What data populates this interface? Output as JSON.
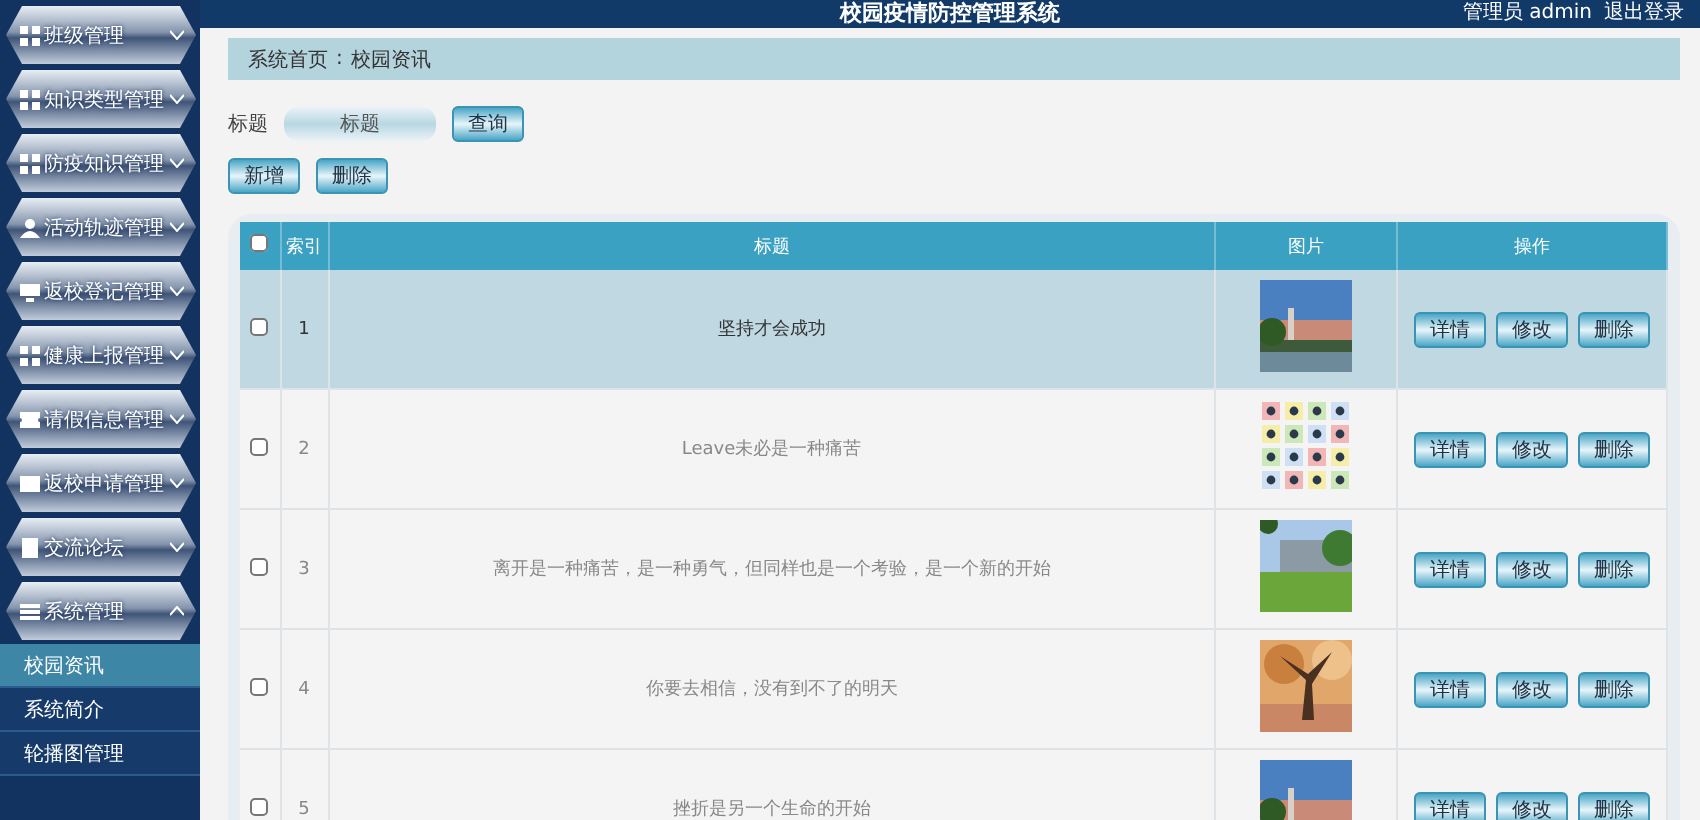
{
  "header": {
    "title": "校园疫情防控管理系统",
    "user": "管理员 admin",
    "logout": "退出登录"
  },
  "sidebar": {
    "items": [
      {
        "label": "班级管理",
        "expanded": false
      },
      {
        "label": "知识类型管理",
        "expanded": false
      },
      {
        "label": "防疫知识管理",
        "expanded": false
      },
      {
        "label": "活动轨迹管理",
        "expanded": false
      },
      {
        "label": "返校登记管理",
        "expanded": false
      },
      {
        "label": "健康上报管理",
        "expanded": false
      },
      {
        "label": "请假信息管理",
        "expanded": false
      },
      {
        "label": "返校申请管理",
        "expanded": false
      },
      {
        "label": "交流论坛",
        "expanded": false
      },
      {
        "label": "系统管理",
        "expanded": true,
        "children": [
          {
            "label": "校园资讯",
            "selected": true
          },
          {
            "label": "系统简介",
            "selected": false
          },
          {
            "label": "轮播图管理",
            "selected": false
          }
        ]
      }
    ]
  },
  "breadcrumb": [
    "系统首页",
    "校园资讯"
  ],
  "breadcrumb_separator": ":",
  "search": {
    "label": "标题",
    "placeholder": "标题",
    "button": "查询"
  },
  "actions": [
    "新增",
    "删除"
  ],
  "table": {
    "columns": [
      "索引",
      "标题",
      "图片",
      "操作"
    ],
    "header_checked": false,
    "rows": [
      {
        "index": "1",
        "title": "坚持才会成功",
        "highlighted": true,
        "checked": false,
        "buttons": [
          "详情",
          "修改",
          "删除"
        ]
      },
      {
        "index": "2",
        "title": "Leave未必是一种痛苦",
        "highlighted": false,
        "checked": false,
        "buttons": [
          "详情",
          "修改",
          "删除"
        ]
      },
      {
        "index": "3",
        "title": "离开是一种痛苦，是一种勇气，但同样也是一个考验，是一个新的开始",
        "highlighted": false,
        "checked": false,
        "buttons": [
          "详情",
          "修改",
          "删除"
        ]
      },
      {
        "index": "4",
        "title": "你要去相信，没有到不了的明天",
        "highlighted": false,
        "checked": false,
        "buttons": [
          "详情",
          "修改",
          "删除"
        ]
      },
      {
        "index": "5",
        "title": "挫折是另一个生命的开始",
        "highlighted": false,
        "checked": false,
        "buttons": [
          "详情",
          "修改",
          "删除"
        ]
      }
    ]
  }
}
